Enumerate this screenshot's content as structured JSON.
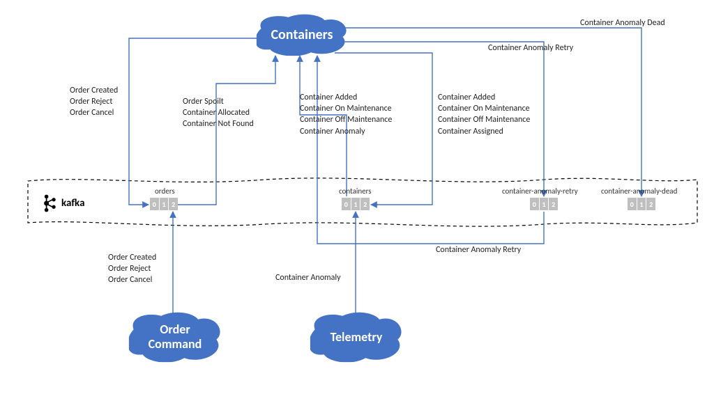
{
  "nodes": {
    "containers": "Containers",
    "order_command": "Order\nCommand",
    "telemetry": "Telemetry"
  },
  "kafka_label": "kafka",
  "topics": {
    "orders": {
      "label": "orders",
      "partitions": [
        "0",
        "1",
        "2"
      ]
    },
    "containers": {
      "label": "containers",
      "partitions": [
        "0",
        "1",
        "2"
      ]
    },
    "retry": {
      "label": "container-anomaly-retry",
      "partitions": [
        "0",
        "1",
        "2"
      ]
    },
    "dead": {
      "label": "container-anomaly-dead",
      "partitions": [
        "0",
        "1",
        "2"
      ]
    }
  },
  "event_groups": {
    "orders_in_top": [
      "Order Created",
      "Order Reject",
      "Order Cancel"
    ],
    "orders_out": [
      "Order Spoilt",
      "Container Allocated",
      "Container Not Found"
    ],
    "containers_in": [
      "Container Added",
      "Container On Maintenance",
      "Container Off Maintenance",
      "Container Anomaly"
    ],
    "containers_out": [
      "Container Added",
      "Container On Maintenance",
      "Container Off Maintenance",
      "Container Assigned"
    ],
    "orders_in_bottom": [
      "Order Created",
      "Order Reject",
      "Order Cancel"
    ]
  },
  "labels": {
    "anomaly_retry_top": "Container Anomaly Retry",
    "anomaly_dead_top": "Container Anomaly Dead",
    "anomaly_retry_bottom": "Container Anomaly Retry",
    "container_anomaly": "Container Anomaly"
  }
}
